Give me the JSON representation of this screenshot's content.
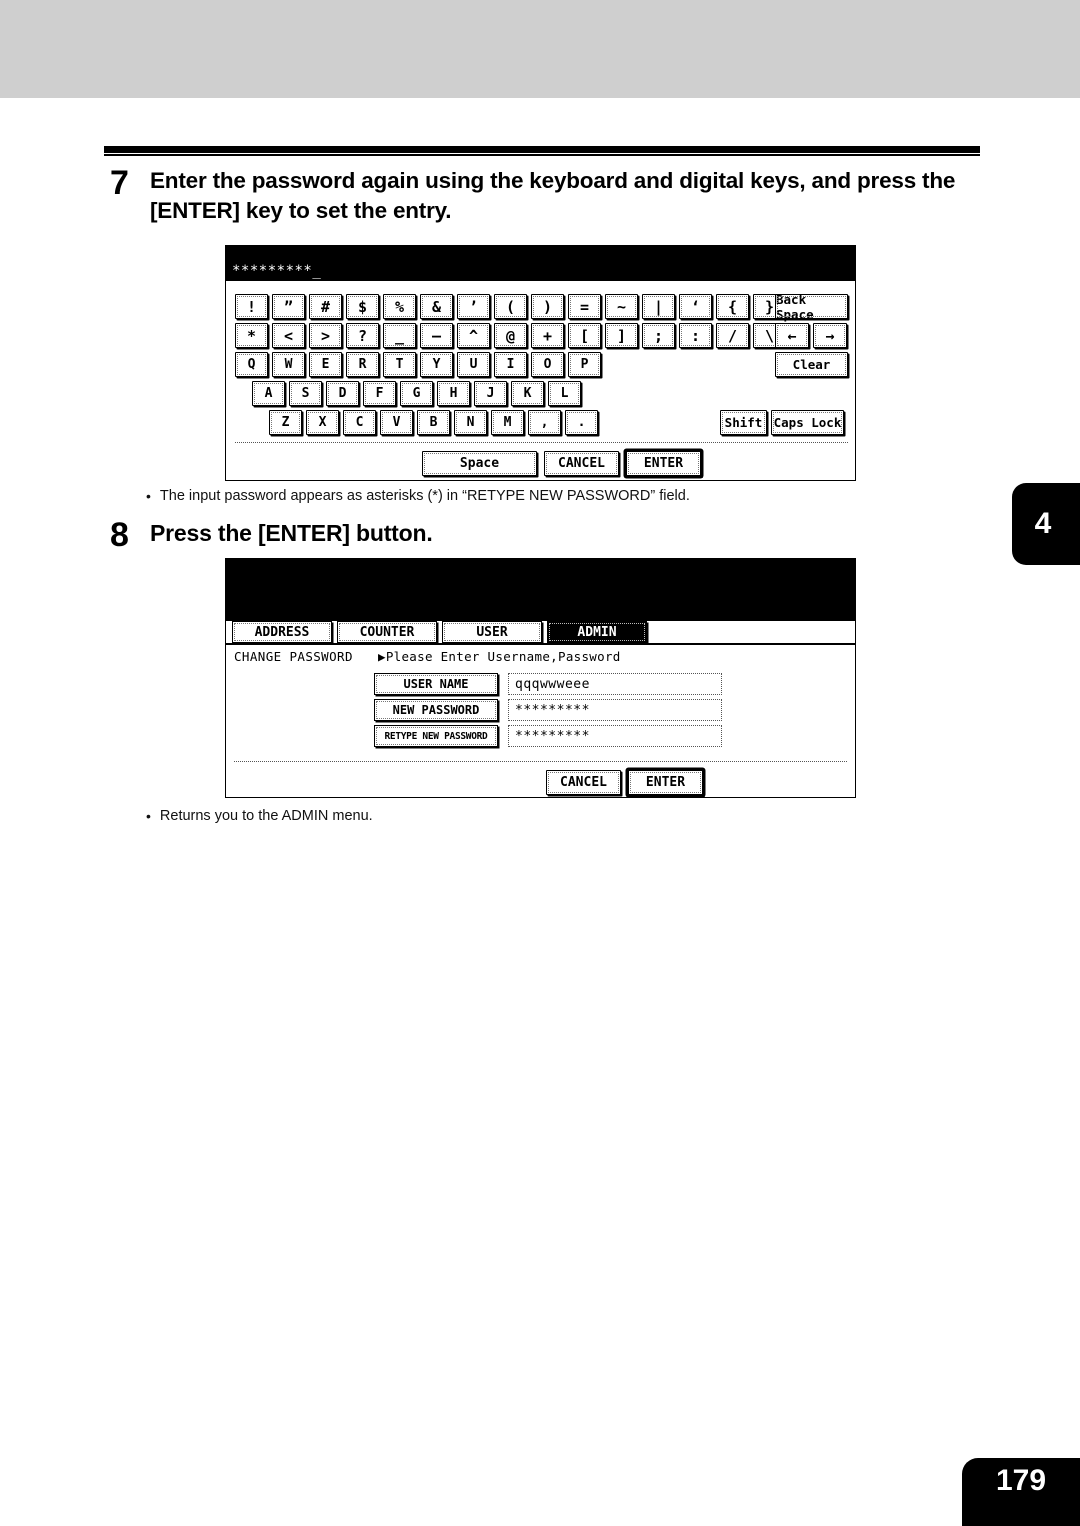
{
  "page": {
    "number": "179",
    "chapter_tab": "4"
  },
  "steps": [
    {
      "number": "7",
      "text": "Enter the password again using the keyboard and digital keys, and press the [ENTER] key to set the entry."
    },
    {
      "number": "8",
      "text": "Press the [ENTER] button."
    }
  ],
  "captions": [
    {
      "bullet": "•",
      "text": "The input password appears as asterisks (*) in “RETYPE NEW PASSWORD” field."
    },
    {
      "bullet": "•",
      "text": "Returns you to the ADMIN menu."
    }
  ],
  "keyboard_panel": {
    "display_value": "*********",
    "cursor": "_",
    "row1": [
      "!",
      "”",
      "#",
      "$",
      "%",
      "&",
      "’",
      "(",
      ")",
      "=",
      "~",
      "|",
      "‘",
      "{",
      "}"
    ],
    "row2": [
      "*",
      "<",
      ">",
      "?",
      "_",
      "—",
      "^",
      "@",
      "+",
      "[",
      "]",
      ";",
      ":",
      "/",
      "\\"
    ],
    "row3": [
      "Q",
      "W",
      "E",
      "R",
      "T",
      "Y",
      "U",
      "I",
      "O",
      "P"
    ],
    "row4": [
      "A",
      "S",
      "D",
      "F",
      "G",
      "H",
      "J",
      "K",
      "L"
    ],
    "row5": [
      "Z",
      "X",
      "C",
      "V",
      "B",
      "N",
      "M",
      ",",
      "."
    ],
    "back_space": "Back Space",
    "arrow_left": "←",
    "arrow_right": "→",
    "clear": "Clear",
    "shift": "Shift",
    "caps_lock": "Caps Lock",
    "space": "Space",
    "cancel": "CANCEL",
    "enter": "ENTER"
  },
  "admin_panel": {
    "tabs": [
      {
        "label": "ADDRESS",
        "active": false
      },
      {
        "label": "COUNTER",
        "active": false
      },
      {
        "label": "USER",
        "active": false
      },
      {
        "label": "ADMIN",
        "active": true
      }
    ],
    "screen_title": "CHANGE PASSWORD",
    "hint": "▶Please Enter Username,Password",
    "fields": [
      {
        "label": "USER NAME",
        "value": "qqqwwweee"
      },
      {
        "label": "NEW PASSWORD",
        "value": "*********"
      },
      {
        "label": "RETYPE NEW PASSWORD",
        "value": "*********"
      }
    ],
    "cancel": "CANCEL",
    "enter": "ENTER"
  },
  "colors": {
    "band": "#cfcfcf",
    "lcd_black": "#000000",
    "paper": "#ffffff"
  }
}
